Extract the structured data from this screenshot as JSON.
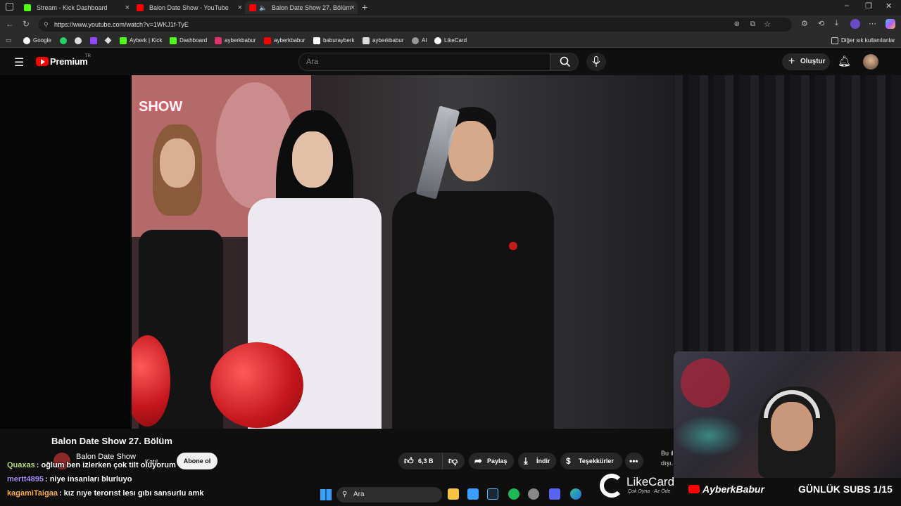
{
  "browser": {
    "tabs": [
      {
        "label": "Stream - Kick Dashboard",
        "favicon_color": "#53fc18"
      },
      {
        "label": "Balon Date Show - YouTube",
        "favicon_color": "#ff0000"
      },
      {
        "label": "Balon Date Show 27. Bölüm",
        "favicon_color": "#ff0000"
      }
    ],
    "new_tab_label": "+",
    "url": "https://www.youtube.com/watch?v=1WKJ1f-TyE",
    "bookmarks": [
      {
        "label": "Google",
        "color": "#ffffff"
      },
      {
        "label": "Ayberk | Kick",
        "color": "#53fc18"
      },
      {
        "label": "Dashboard",
        "color": "#53fc18"
      },
      {
        "label": "ayberkbabur",
        "color": "#e1306c"
      },
      {
        "label": "ayberkbabur",
        "color": "#ff0000"
      },
      {
        "label": "baburayberk",
        "color": "#ffffff"
      },
      {
        "label": "ayberkbabur",
        "color": "#ffffff"
      },
      {
        "label": "AI",
        "color": "#aaaaaa"
      },
      {
        "label": "LikeCard",
        "color": "#ffffff"
      }
    ],
    "other_bookmarks": "Diğer sık kullanılanlar"
  },
  "youtube": {
    "logo": "Premium",
    "logo_region": "TR",
    "search_placeholder": "Ara",
    "create_label": "Oluştur",
    "video": {
      "title": "Balon Date Show 27. Bölüm",
      "poster_text": "SHOW",
      "channel": "Balon Date Show",
      "join_label": "Katıl",
      "subscribe_label": "Abone ol",
      "likes": "6,3 B",
      "share_label": "Paylaş",
      "download_label": "İndir",
      "thanks_label": "Teşekkürler",
      "side_note_1": "Bu il",
      "side_note_2": "dışı."
    }
  },
  "chat": [
    {
      "user": "Quaxas",
      "user_color": "#b8e06a",
      "text": ": oğlum ben izlerken çok tilt oluyorum"
    },
    {
      "user": "mertt4895",
      "user_color": "#a98ff7",
      "text": ": niye insanları blurluyo"
    },
    {
      "user": "kagamiTaigaa",
      "user_color": "#ffb03a",
      "text": ": kız nıye terorıst lesı gıbı sansurlu amk"
    }
  ],
  "taskbar": {
    "search_placeholder": "Ara"
  },
  "overlay": {
    "likecard_name": "LikeCard",
    "likecard_tagline": "Çok Oyna · Az Öde",
    "youtube_handle": "AyberkBabur",
    "daily_subs": "GÜNLÜK SUBS 1/15"
  }
}
